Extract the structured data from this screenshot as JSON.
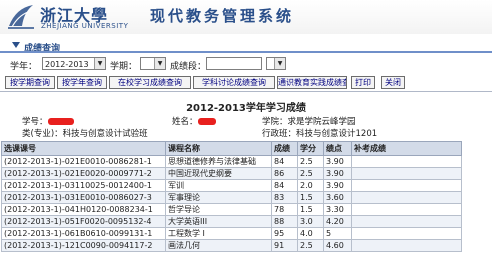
{
  "banner": {
    "school_cn": "浙江大學",
    "school_en": "ZHEJIANG UNIVERSITY",
    "system_title": "现代教务管理系统"
  },
  "section": {
    "title": "成绩查询"
  },
  "query": {
    "year_label": "学年：",
    "year_value": "2012-2013",
    "term_label": "学期：",
    "term_value": "",
    "segment_label": "成绩段："
  },
  "buttons": [
    "按学期查询",
    "按学年查询",
    "在校学习成绩查询",
    "学科讨论成绩查询",
    "通识教育实践成绩查询",
    "打印",
    "关闭"
  ],
  "report": {
    "title": "2012-2013学年学习成绩",
    "student_id_label": "学号：",
    "name_label": "姓名：",
    "college": "学院：求是学院云峰学园",
    "major": "类(专业)：科技与创意设计试验班",
    "class": "行政班：科技与创意设计1201"
  },
  "table": {
    "headers": [
      "选课课号",
      "课程名称",
      "成绩",
      "学分",
      "绩点",
      "补考成绩"
    ],
    "rows": [
      [
        "(2012-2013-1)-021E0010-0086281-1",
        "思想道德修养与法律基础",
        "84",
        "2.5",
        "3.90",
        ""
      ],
      [
        "(2012-2013-1)-021E0020-0009771-2",
        "中国近现代史纲要",
        "86",
        "2.5",
        "3.90",
        ""
      ],
      [
        "(2012-2013-1)-03110025-0012400-1",
        "军训",
        "84",
        "2.0",
        "3.90",
        ""
      ],
      [
        "(2012-2013-1)-031E0010-0086027-3",
        "军事理论",
        "83",
        "1.5",
        "3.60",
        ""
      ],
      [
        "(2012-2013-1)-041H0120-0088234-1",
        "哲学导论",
        "78",
        "1.5",
        "3.30",
        ""
      ],
      [
        "(2012-2013-1)-051F0020-0095132-4",
        "大学英语III",
        "88",
        "3.0",
        "4.20",
        ""
      ],
      [
        "(2012-2013-1)-061B0610-0099131-1",
        "工程数学 I",
        "95",
        "4.0",
        "5",
        ""
      ],
      [
        "(2012-2013-1)-121C0090-0094117-2",
        "画法几何",
        "91",
        "2.5",
        "4.60",
        ""
      ]
    ]
  },
  "colors": {
    "brand_blue": "#2a4f8a",
    "redaction": "#e8201e"
  }
}
